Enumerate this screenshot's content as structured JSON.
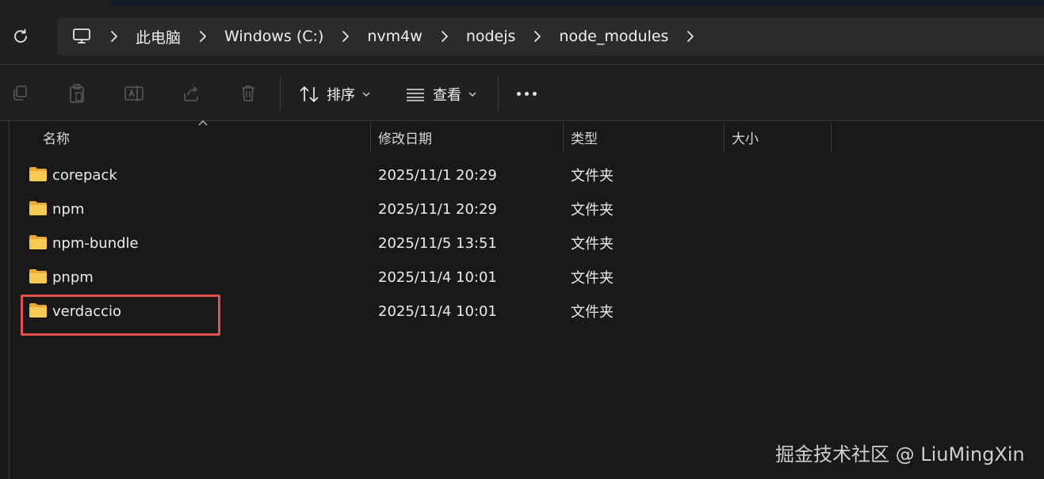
{
  "breadcrumb": [
    "此电脑",
    "Windows (C:)",
    "nvm4w",
    "nodejs",
    "node_modules"
  ],
  "toolbar": {
    "sort_label": "排序",
    "view_label": "查看"
  },
  "columns": [
    "名称",
    "修改日期",
    "类型",
    "大小"
  ],
  "files": [
    {
      "name": "corepack",
      "date": "2025/11/1 20:29",
      "type": "文件夹"
    },
    {
      "name": "npm",
      "date": "2025/11/1 20:29",
      "type": "文件夹"
    },
    {
      "name": "npm-bundle",
      "date": "2025/11/5 13:51",
      "type": "文件夹"
    },
    {
      "name": "pnpm",
      "date": "2025/11/4 10:01",
      "type": "文件夹"
    },
    {
      "name": "verdaccio",
      "date": "2025/11/4 10:01",
      "type": "文件夹"
    }
  ],
  "watermark": "掘金技术社区 @ LiuMingXin",
  "colors": {
    "highlight": "#e05252",
    "folder": "#f2c14e"
  }
}
